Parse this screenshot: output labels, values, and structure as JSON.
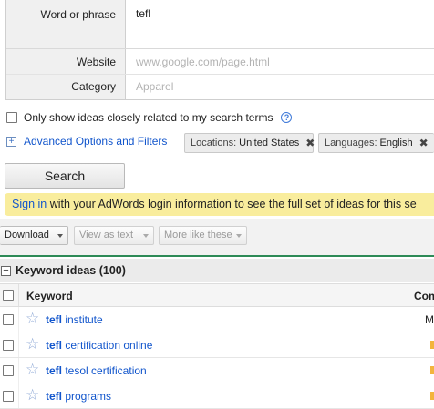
{
  "form": {
    "word_label": "Word or phrase",
    "word_value": "tefl",
    "website_label": "Website",
    "website_placeholder": "www.google.com/page.html",
    "category_label": "Category",
    "category_placeholder": "Apparel"
  },
  "only_related": {
    "label": "Only show ideas closely related to my search terms",
    "checked": false
  },
  "advanced": {
    "label": "Advanced Options and Filters",
    "chips": [
      {
        "key": "Locations:",
        "value": "United States"
      },
      {
        "key": "Languages:",
        "value": "English"
      }
    ]
  },
  "search_button": "Search",
  "banner": {
    "link": "Sign in",
    "text": " with your AdWords login information to see the full set of ideas for this se"
  },
  "toolbar": {
    "download": "Download",
    "view_as_text": "View as text",
    "more_like_these": "More like these"
  },
  "ideas": {
    "title": "Keyword ideas (100)",
    "columns": {
      "keyword": "Keyword",
      "competition": "Com"
    },
    "rows": [
      {
        "bold": "tefl",
        "rest": " institute",
        "competition": "M"
      },
      {
        "bold": "tefl",
        "rest": " certification online",
        "competition": ""
      },
      {
        "bold": "tefl",
        "rest": " tesol certification",
        "competition": ""
      },
      {
        "bold": "tefl",
        "rest": " programs",
        "competition": ""
      }
    ]
  },
  "colors": {
    "link": "#1155cc",
    "banner_bg": "#f9ed9d",
    "accent_line": "#2e8b57",
    "competition_bar": "#f3b43c"
  },
  "icons": {
    "help": "help-icon",
    "expand": "plus-icon",
    "collapse": "minus-icon",
    "remove_chip": "x-icon",
    "star": "star-icon",
    "dropdown": "caret-down-icon"
  }
}
